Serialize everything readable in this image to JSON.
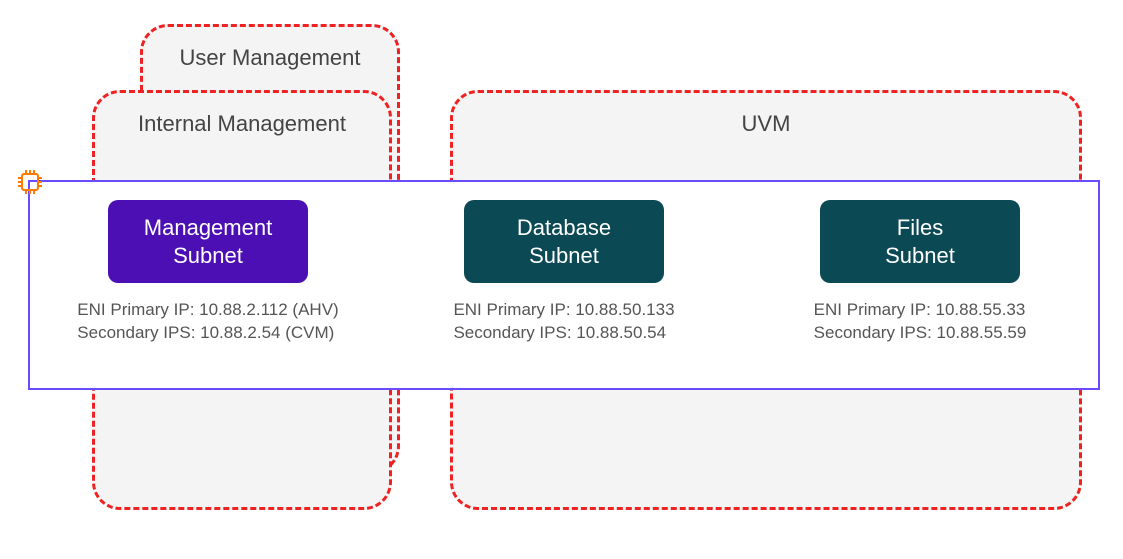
{
  "zones": {
    "user_management": {
      "label": "User Management"
    },
    "internal_management": {
      "label": "Internal Management"
    },
    "uvm": {
      "label": "UVM"
    }
  },
  "subnets": [
    {
      "name": "Management Subnet",
      "color": "purple",
      "primary_ip_label": "ENI Primary IP: 10.88.2.112 (AHV)",
      "secondary_ip_label": "Secondary IPS: 10.88.2.54 (CVM)"
    },
    {
      "name": "Database Subnet",
      "color": "teal",
      "primary_ip_label": "ENI Primary IP: 10.88.50.133",
      "secondary_ip_label": "Secondary IPS: 10.88.50.54"
    },
    {
      "name": "Files Subnet",
      "color": "teal",
      "primary_ip_label": "ENI Primary IP: 10.88.55.33",
      "secondary_ip_label": "Secondary IPS: 10.88.55.59"
    }
  ],
  "icons": {
    "chip": "chip-icon"
  }
}
